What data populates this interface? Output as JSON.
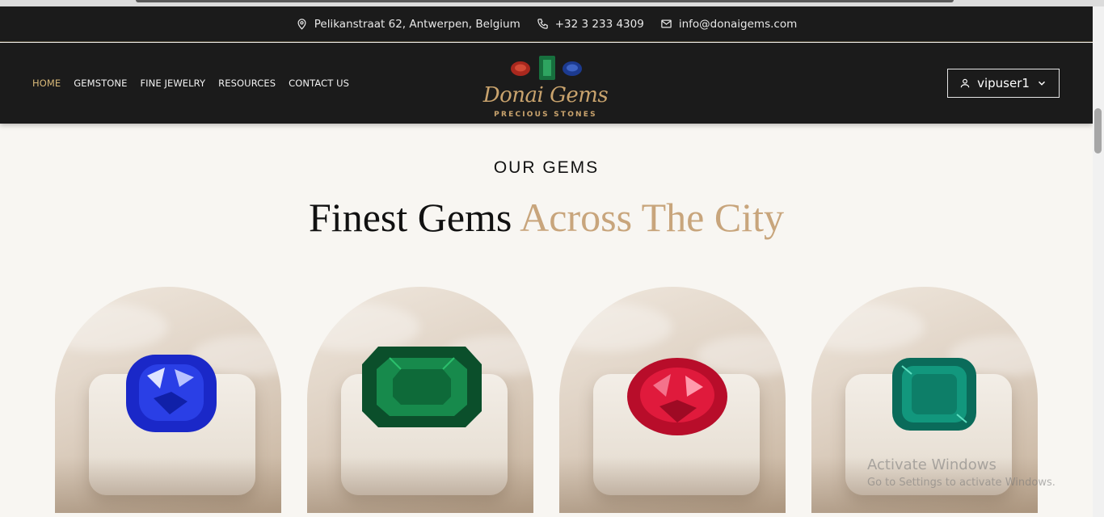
{
  "contact": {
    "address": "Pelikanstraat 62, Antwerpen, Belgium",
    "phone": "+32 3 233 4309",
    "email": "info@donaigems.com"
  },
  "nav": {
    "items": [
      "HOME",
      "GEMSTONE",
      "FINE JEWELRY",
      "RESOURCES",
      "CONTACT US"
    ],
    "active": "HOME"
  },
  "logo": {
    "name": "Donai Gems",
    "tagline": "PRECIOUS STONES"
  },
  "user": {
    "name": "vipuser1"
  },
  "section": {
    "eyebrow": "OUR GEMS",
    "title_main": "Finest Gems",
    "title_accent": "Across The City"
  },
  "gems": [
    {
      "name": "sapphire",
      "color": "#1f2fd6"
    },
    {
      "name": "emerald",
      "color": "#0f6b3c"
    },
    {
      "name": "ruby",
      "color": "#c4122e"
    },
    {
      "name": "tourmaline",
      "color": "#0f8a73"
    }
  ],
  "colors": {
    "accent": "#c8a57c",
    "nav_bg": "#1b1b1b",
    "active": "#d8b878"
  },
  "watermark": {
    "line1": "Activate Windows",
    "line2": "Go to Settings to activate Windows."
  }
}
